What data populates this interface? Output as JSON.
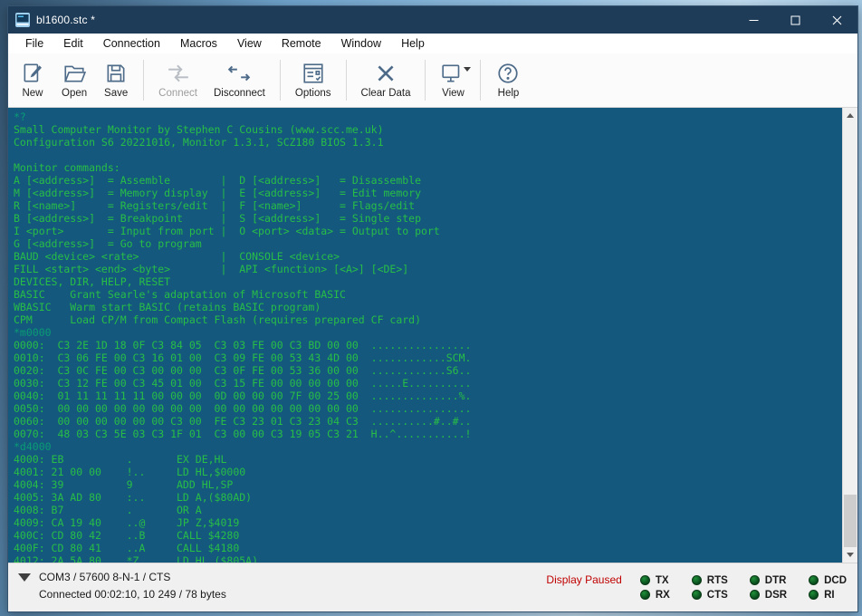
{
  "window": {
    "title": "bl1600.stc *"
  },
  "menu": {
    "items": [
      "File",
      "Edit",
      "Connection",
      "Macros",
      "View",
      "Remote",
      "Window",
      "Help"
    ]
  },
  "toolbar": {
    "buttons": [
      {
        "label": "New",
        "icon": "new-document-icon",
        "enabled": true,
        "group": 1
      },
      {
        "label": "Open",
        "icon": "open-folder-icon",
        "enabled": true,
        "group": 1
      },
      {
        "label": "Save",
        "icon": "save-icon",
        "enabled": true,
        "group": 1
      },
      {
        "label": "Connect",
        "icon": "connect-icon",
        "enabled": false,
        "group": 2
      },
      {
        "label": "Disconnect",
        "icon": "disconnect-icon",
        "enabled": true,
        "group": 2
      },
      {
        "label": "Options",
        "icon": "options-icon",
        "enabled": true,
        "group": 3
      },
      {
        "label": "Clear Data",
        "icon": "clear-data-icon",
        "enabled": true,
        "group": 4
      },
      {
        "label": "View",
        "icon": "view-icon",
        "enabled": true,
        "group": 5,
        "has_dropdown": true
      },
      {
        "label": "Help",
        "icon": "help-icon",
        "enabled": true,
        "group": 6
      }
    ]
  },
  "terminal": {
    "lines": [
      {
        "kind": "command",
        "text": "*?"
      },
      {
        "kind": "output",
        "text": "Small Computer Monitor by Stephen C Cousins (www.scc.me.uk)"
      },
      {
        "kind": "output",
        "text": "Configuration S6 20221016, Monitor 1.3.1, SCZ180 BIOS 1.3.1"
      },
      {
        "kind": "output",
        "text": ""
      },
      {
        "kind": "output",
        "text": "Monitor commands:"
      },
      {
        "kind": "output",
        "text": "A [<address>]  = Assemble        |  D [<address>]   = Disassemble"
      },
      {
        "kind": "output",
        "text": "M [<address>]  = Memory display  |  E [<address>]   = Edit memory"
      },
      {
        "kind": "output",
        "text": "R [<name>]     = Registers/edit  |  F [<name>]      = Flags/edit"
      },
      {
        "kind": "output",
        "text": "B [<address>]  = Breakpoint      |  S [<address>]   = Single step"
      },
      {
        "kind": "output",
        "text": "I <port>       = Input from port |  O <port> <data> = Output to port"
      },
      {
        "kind": "output",
        "text": "G [<address>]  = Go to program"
      },
      {
        "kind": "output",
        "text": "BAUD <device> <rate>             |  CONSOLE <device>"
      },
      {
        "kind": "output",
        "text": "FILL <start> <end> <byte>        |  API <function> [<A>] [<DE>]"
      },
      {
        "kind": "output",
        "text": "DEVICES, DIR, HELP, RESET"
      },
      {
        "kind": "output",
        "text": "BASIC    Grant Searle's adaptation of Microsoft BASIC"
      },
      {
        "kind": "output",
        "text": "WBASIC   Warm start BASIC (retains BASIC program)"
      },
      {
        "kind": "output",
        "text": "CPM      Load CP/M from Compact Flash (requires prepared CF card)"
      },
      {
        "kind": "command",
        "text": "*m0000"
      },
      {
        "kind": "output",
        "text": "0000:  C3 2E 1D 18 0F C3 84 05  C3 03 FE 00 C3 BD 00 00  ................"
      },
      {
        "kind": "output",
        "text": "0010:  C3 06 FE 00 C3 16 01 00  C3 09 FE 00 53 43 4D 00  ............SCM."
      },
      {
        "kind": "output",
        "text": "0020:  C3 0C FE 00 C3 00 00 00  C3 0F FE 00 53 36 00 00  ............S6.."
      },
      {
        "kind": "output",
        "text": "0030:  C3 12 FE 00 C3 45 01 00  C3 15 FE 00 00 00 00 00  .....E.........."
      },
      {
        "kind": "output",
        "text": "0040:  01 11 11 11 11 00 00 00  0D 00 00 00 7F 00 25 00  ..............%."
      },
      {
        "kind": "output",
        "text": "0050:  00 00 00 00 00 00 00 00  00 00 00 00 00 00 00 00  ................"
      },
      {
        "kind": "output",
        "text": "0060:  00 00 00 00 00 00 C3 00  FE C3 23 01 C3 23 04 C3  ..........#..#.."
      },
      {
        "kind": "output",
        "text": "0070:  48 03 C3 5E 03 C3 1F 01  C3 00 00 C3 19 05 C3 21  H..^...........!"
      },
      {
        "kind": "command",
        "text": "*d4000"
      },
      {
        "kind": "output",
        "text": "4000: EB          .       EX DE,HL"
      },
      {
        "kind": "output",
        "text": "4001: 21 00 00    !..     LD HL,$0000"
      },
      {
        "kind": "output",
        "text": "4004: 39          9       ADD HL,SP"
      },
      {
        "kind": "output",
        "text": "4005: 3A AD 80    :..     LD A,($80AD)"
      },
      {
        "kind": "output",
        "text": "4008: B7          .       OR A"
      },
      {
        "kind": "output",
        "text": "4009: CA 19 40    ..@     JP Z,$4019"
      },
      {
        "kind": "output",
        "text": "400C: CD 80 42    ..B     CALL $4280"
      },
      {
        "kind": "output",
        "text": "400F: CD 80 41    ..A     CALL $4180"
      },
      {
        "kind": "output",
        "text": "4012: 2A 5A 80    *Z.     LD HL,($805A)"
      }
    ]
  },
  "statusbar": {
    "connection_line1": "COM3 / 57600 8-N-1 / CTS",
    "connection_line2": "Connected 00:02:10, 10 249 / 78 bytes",
    "display_paused": "Display Paused",
    "leds": [
      "TX",
      "RTS",
      "DTR",
      "DCD",
      "RX",
      "CTS",
      "DSR",
      "RI"
    ]
  },
  "colors": {
    "titlebar_bg": "#1e3c58",
    "terminal_bg": "#14587e",
    "terminal_text": "#28be46",
    "terminal_command": "#0a9c74",
    "toolbar_icon": "#4d6b89",
    "paused_red": "#c00000",
    "led_green": "#07451a"
  }
}
